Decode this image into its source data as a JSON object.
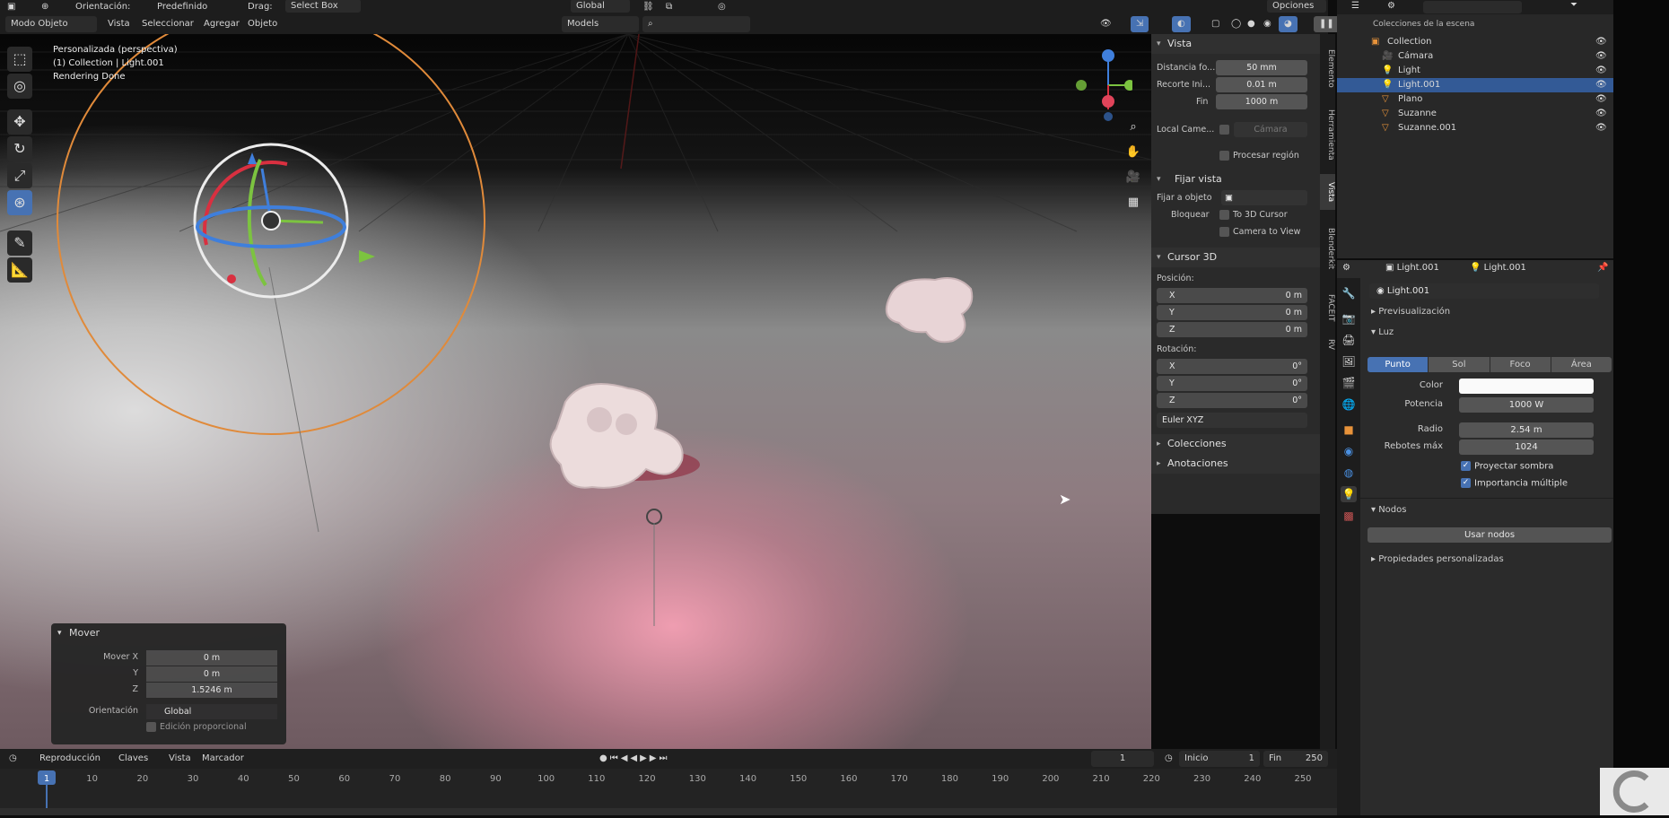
{
  "header_top": {
    "orientation_label": "Orientación:",
    "orientation_value": "Predefinido",
    "drag_label": "Drag:",
    "drag_value": "Select Box",
    "transform_value": "Global",
    "options_label": "Opciones"
  },
  "header": {
    "mode": "Modo Objeto",
    "menu": [
      "Vista",
      "Seleccionar",
      "Agregar",
      "Objeto"
    ],
    "models_label": "Models"
  },
  "viewport": {
    "info_line1": "Personalizada (perspectiva)",
    "info_line2": "(1) Collection | Light.001",
    "info_line3": "Rendering Done"
  },
  "npanel": {
    "vista_title": "Vista",
    "focal_label": "Distancia fo...",
    "focal_value": "50 mm",
    "clip_start_label": "Recorte Ini...",
    "clip_start_value": "0.01 m",
    "clip_end_label": "Fin",
    "clip_end_value": "1000 m",
    "local_camera_label": "Local Came...",
    "local_camera_value": "Cámara",
    "render_region_label": "Procesar región",
    "lock_title": "Fijar vista",
    "lock_object_label": "Fijar a objeto",
    "lock_label": "Bloquear",
    "to_cursor_label": "To 3D Cursor",
    "camera_to_view_label": "Camera to View",
    "cursor_title": "Cursor 3D",
    "position_label": "Posición:",
    "pos": [
      {
        "axis": "X",
        "value": "0 m"
      },
      {
        "axis": "Y",
        "value": "0 m"
      },
      {
        "axis": "Z",
        "value": "0 m"
      }
    ],
    "rotation_label": "Rotación:",
    "rot": [
      {
        "axis": "X",
        "value": "0°"
      },
      {
        "axis": "Y",
        "value": "0°"
      },
      {
        "axis": "Z",
        "value": "0°"
      }
    ],
    "euler_value": "Euler XYZ",
    "collections_label": "Colecciones",
    "annotations_label": "Anotaciones"
  },
  "vtabs": [
    "Elemento",
    "Herramienta",
    "Vista",
    "Blenderkit",
    "FACEIT",
    "RV"
  ],
  "outliner": {
    "title": "Colecciones de la escena",
    "items": [
      {
        "name": "Collection",
        "depth": 1
      },
      {
        "name": "Cámara",
        "depth": 2
      },
      {
        "name": "Light",
        "depth": 2
      },
      {
        "name": "Light.001",
        "depth": 2
      },
      {
        "name": "Plano",
        "depth": 2
      },
      {
        "name": "Suzanne",
        "depth": 2
      },
      {
        "name": "Suzanne.001",
        "depth": 2
      }
    ]
  },
  "properties": {
    "object_name": "Light.001",
    "data_name": "Light.001",
    "light_field": "Light.001",
    "preview_label": "Previsualización",
    "light_section": "Luz",
    "light_types": [
      "Punto",
      "Sol",
      "Foco",
      "Área"
    ],
    "color_label": "Color",
    "power_label": "Potencia",
    "power_value": "1000 W",
    "radius_label": "Radio",
    "radius_value": "2.54 m",
    "bounces_label": "Rebotes máx",
    "bounces_value": "1024",
    "cast_shadow_label": "Proyectar sombra",
    "multiple_importance_label": "Importancia múltiple",
    "nodes_label": "Nodos",
    "use_nodes_label": "Usar nodos",
    "custom_props_label": "Propiedades personalizadas"
  },
  "mover": {
    "title": "Mover",
    "x_label": "Mover X",
    "x_value": "0 m",
    "y_label": "Y",
    "y_value": "0 m",
    "z_label": "Z",
    "z_value": "1.5246 m",
    "orientation_label": "Orientación",
    "orientation_value": "Global",
    "proportional_label": "Edición proporcional"
  },
  "timeline": {
    "menus": [
      "Reproducción",
      "Claves",
      "Vista",
      "Marcador"
    ],
    "current_frame": "1",
    "start_label": "Inicio",
    "start_value": "1",
    "end_label": "Fin",
    "end_value": "250",
    "ticks": [
      "1",
      "10",
      "20",
      "30",
      "40",
      "50",
      "60",
      "70",
      "80",
      "90",
      "100",
      "110",
      "120",
      "130",
      "140",
      "150",
      "160",
      "170",
      "180",
      "190",
      "200",
      "210",
      "220",
      "230",
      "240",
      "250"
    ]
  },
  "colors": {
    "accent": "#4772b3",
    "selection": "#335a96",
    "light_circle": "#e08a3a"
  }
}
